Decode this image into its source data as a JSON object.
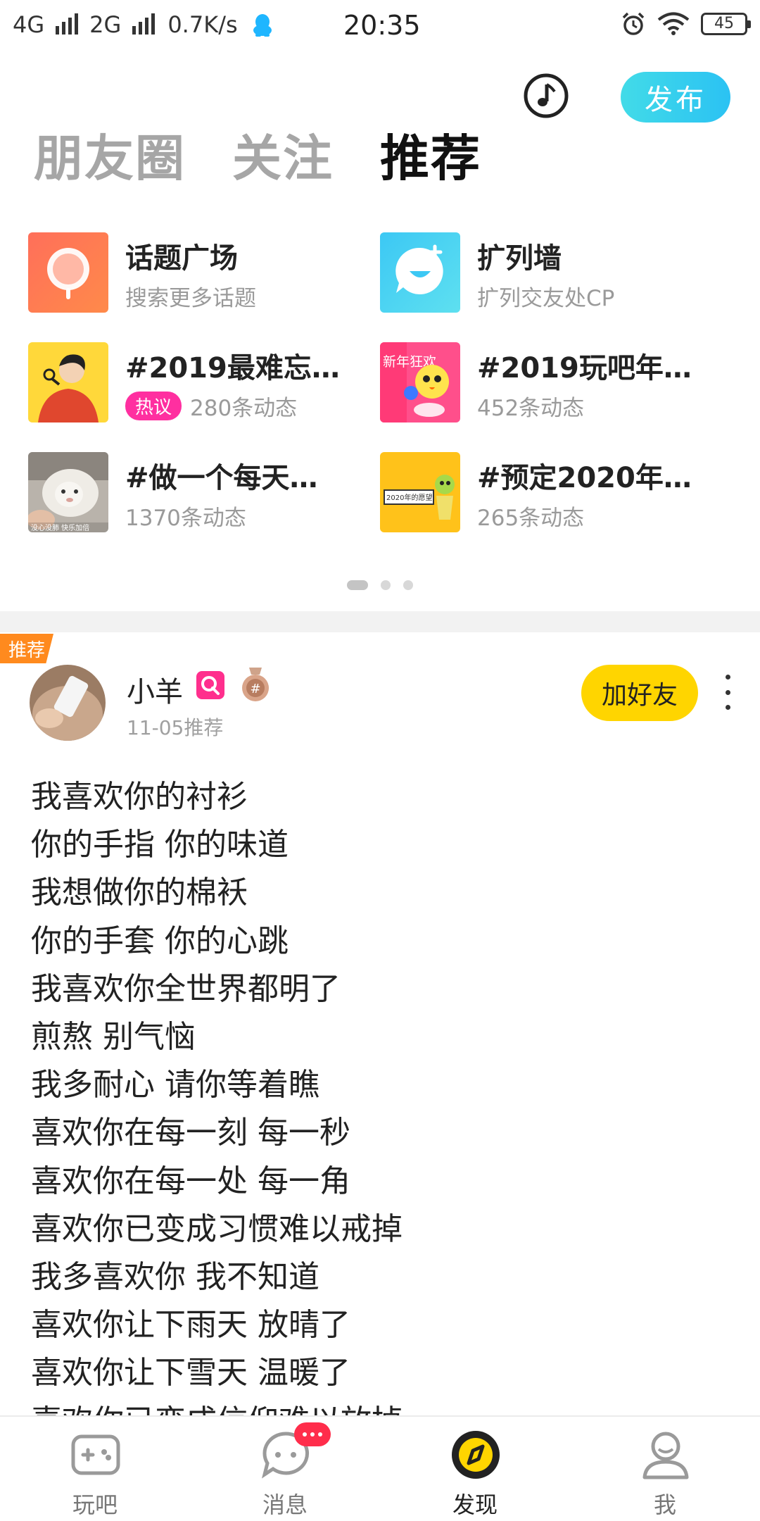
{
  "status_bar": {
    "network1": "4G",
    "network2": "2G",
    "speed": "0.7K/s",
    "time": "20:35",
    "battery": "45"
  },
  "header": {
    "publish_label": "发布",
    "tabs": [
      {
        "label": "朋友圈",
        "active": false
      },
      {
        "label": "关注",
        "active": false
      },
      {
        "label": "推荐",
        "active": true
      }
    ]
  },
  "topics": [
    {
      "title": "话题广场",
      "subtitle": "搜索更多话题",
      "icon": "search-icon"
    },
    {
      "title": "扩列墙",
      "subtitle": "扩列交友处CP",
      "icon": "chat-bubble-icon"
    },
    {
      "title": "#2019最难忘…",
      "badge": "热议",
      "subtitle": "280条动态",
      "icon": "illustration-thumbnail"
    },
    {
      "title": "#2019玩吧年…",
      "subtitle": "452条动态",
      "icon": "new-year-thumbnail",
      "thumb_text": "新年狂欢"
    },
    {
      "title": "#做一个每天…",
      "subtitle": "1370条动态",
      "icon": "lamb-photo-thumbnail",
      "thumb_text": "没心没肺 快乐加倍"
    },
    {
      "title": "#预定2020年…",
      "subtitle": "265条动态",
      "icon": "cartoon-thumbnail",
      "thumb_text": "2020年的愿望"
    }
  ],
  "pager": {
    "pages": 3,
    "current": 1
  },
  "post": {
    "tag": "推荐",
    "username": "小羊",
    "date": "11-05推荐",
    "add_friend_label": "加好友",
    "lines": [
      "我喜欢你的衬衫",
      "你的手指 你的味道",
      "我想做你的棉袄",
      "你的手套 你的心跳",
      "我喜欢你全世界都明了",
      "煎熬 别气恼",
      "我多耐心 请你等着瞧",
      "喜欢你在每一刻 每一秒",
      "喜欢你在每一处 每一角",
      "喜欢你已变成习惯难以戒掉",
      "我多喜欢你 我不知道",
      "喜欢你让下雨天 放晴了",
      "喜欢你让下雪天 温暖了",
      "喜欢你已变成信仰难以放掉"
    ]
  },
  "bottom_nav": [
    {
      "label": "玩吧",
      "icon": "gamepad-icon",
      "active": false
    },
    {
      "label": "消息",
      "icon": "message-icon",
      "active": false,
      "badge": true
    },
    {
      "label": "发现",
      "icon": "compass-icon",
      "active": true
    },
    {
      "label": "我",
      "icon": "user-icon",
      "active": false
    }
  ],
  "colors": {
    "accent_yellow": "#ffd500",
    "publish_cyan": "#2bc2f3",
    "hot_pink": "#ff2fa0",
    "rec_orange": "#ff8a1e"
  }
}
